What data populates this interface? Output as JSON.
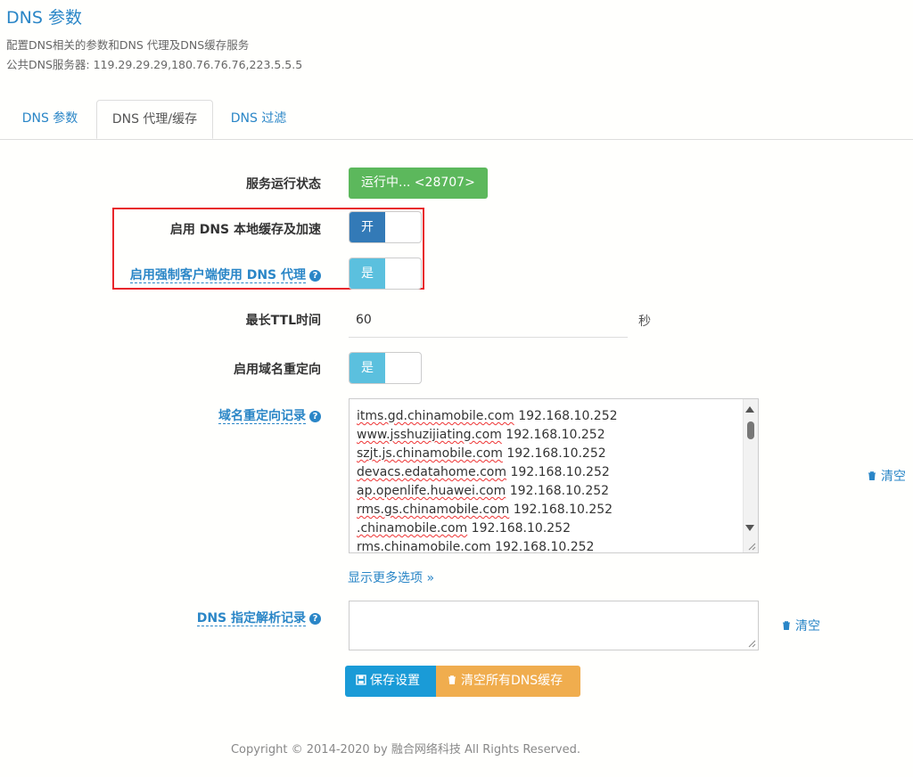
{
  "header": {
    "title": "DNS 参数",
    "description": "配置DNS相关的参数和DNS 代理及DNS缓存服务",
    "public_dns": "公共DNS服务器: 119.29.29.29,180.76.76.76,223.5.5.5"
  },
  "tabs": [
    {
      "label": "DNS 参数",
      "active": false
    },
    {
      "label": "DNS 代理/缓存",
      "active": true
    },
    {
      "label": "DNS 过滤",
      "active": false
    }
  ],
  "form": {
    "service_status": {
      "label": "服务运行状态",
      "value": "运行中... <28707>"
    },
    "local_cache": {
      "label": "启用 DNS 本地缓存及加速",
      "switch_text": "开",
      "enabled": true
    },
    "force_proxy": {
      "label": "启用强制客户端使用 DNS 代理",
      "switch_text": "是",
      "enabled": true
    },
    "max_ttl": {
      "label": "最长TTL时间",
      "value": "60",
      "unit": "秒"
    },
    "domain_redirect": {
      "label": "启用域名重定向",
      "switch_text": "是",
      "enabled": true
    },
    "redirect_records": {
      "label": "域名重定向记录",
      "lines": [
        {
          "domain": "itms.gd.chinamobile.com",
          "ip": "192.168.10.252"
        },
        {
          "domain": "www.jsshuzijiating.com",
          "ip": "192.168.10.252"
        },
        {
          "domain": "szjt.js.chinamobile.com",
          "ip": "192.168.10.252"
        },
        {
          "domain": "devacs.edatahome.com",
          "ip": "192.168.10.252"
        },
        {
          "domain": "ap.openlife.huawei.com",
          "ip": "192.168.10.252"
        },
        {
          "domain": "rms.gs.chinamobile.com",
          "ip": "192.168.10.252"
        },
        {
          "domain": ".chinamobile.com",
          "ip": "192.168.10.252"
        },
        {
          "domain": "rms.chinamobile.com",
          "ip": "192.168.10.252"
        }
      ],
      "clear_label": "清空"
    },
    "show_more": "显示更多选项 »",
    "dns_records": {
      "label": "DNS 指定解析记录",
      "value": "",
      "clear_label": "清空"
    },
    "save_label": "保存设置",
    "clear_cache_label": "清空所有DNS缓存"
  },
  "footer": "Copyright © 2014-2020 by 融合网络科技 All Rights Reserved.",
  "colors": {
    "link": "#2a86c7",
    "status_green": "#5cb85c",
    "switch_dark": "#337ab7",
    "switch_light": "#5bc0de",
    "save_blue": "#1a9bd7",
    "clear_orange": "#f0ad4e",
    "highlight_red": "#e8262b"
  }
}
